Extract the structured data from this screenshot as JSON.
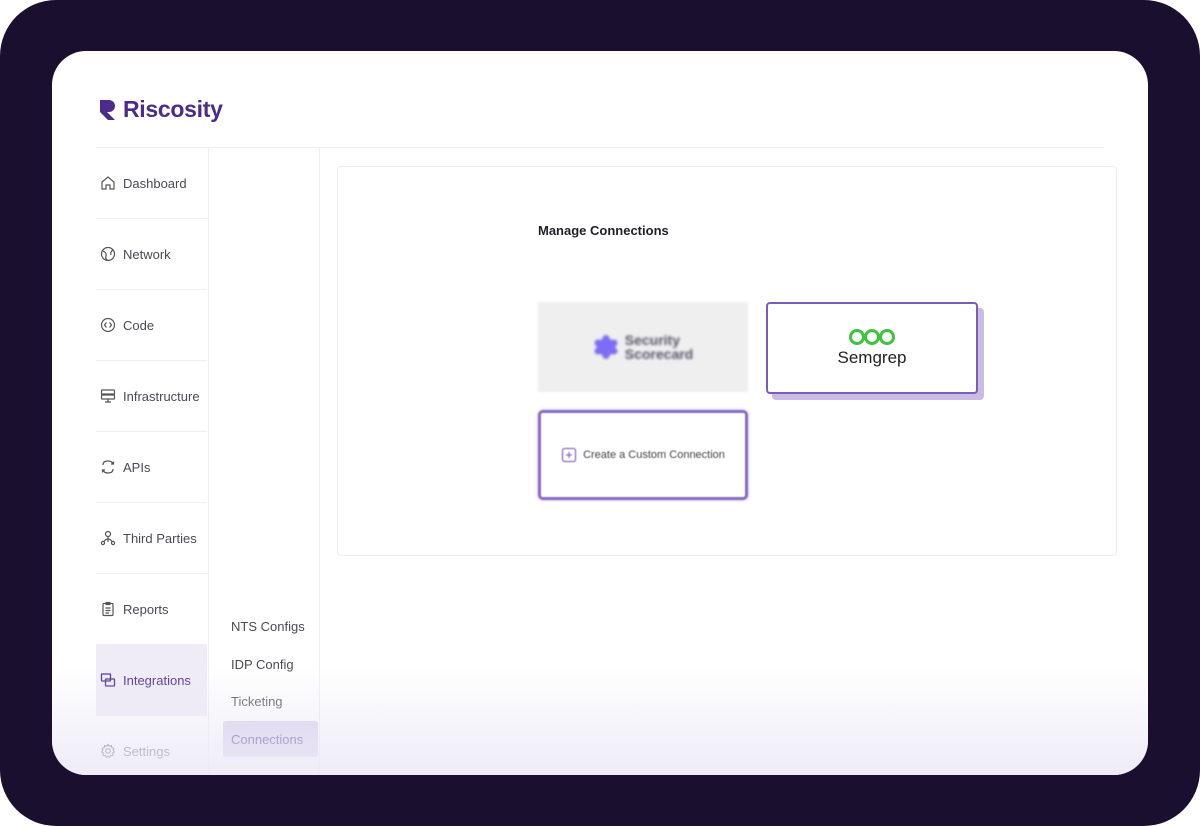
{
  "brand": {
    "name": "Riscosity",
    "color": "#4b2c8c"
  },
  "sidebar": {
    "items": [
      {
        "label": "Dashboard",
        "icon": "home-icon",
        "active": false
      },
      {
        "label": "Network",
        "icon": "globe-icon",
        "active": false
      },
      {
        "label": "Code",
        "icon": "code-icon",
        "active": false
      },
      {
        "label": "Infrastructure",
        "icon": "server-icon",
        "active": false
      },
      {
        "label": "APIs",
        "icon": "api-icon",
        "active": false
      },
      {
        "label": "Third Parties",
        "icon": "third-parties-icon",
        "active": false
      },
      {
        "label": "Reports",
        "icon": "clipboard-icon",
        "active": false
      },
      {
        "label": "Integrations",
        "icon": "integrations-icon",
        "active": true
      },
      {
        "label": "Settings",
        "icon": "gear-icon",
        "active": false
      }
    ]
  },
  "subnav": {
    "items": [
      {
        "label": "NTS Configs",
        "active": false
      },
      {
        "label": "IDP Config",
        "active": false
      },
      {
        "label": "Ticketing",
        "active": false
      },
      {
        "label": "Connections",
        "active": true
      }
    ]
  },
  "main": {
    "title": "Manage Connections",
    "connections": [
      {
        "name": "Security Scorecard",
        "line1": "Security",
        "line2": "Scorecard",
        "icon": "security-scorecard-logo-icon"
      },
      {
        "name": "Semgrep",
        "icon": "semgrep-logo-icon",
        "selected": true
      }
    ],
    "custom": {
      "label": "Create a Custom Connection",
      "icon": "plus-square-icon"
    }
  },
  "colors": {
    "accent": "#7b5cb8",
    "active_bg": "#efebf7",
    "semgrep_green": "#3ec33e"
  }
}
